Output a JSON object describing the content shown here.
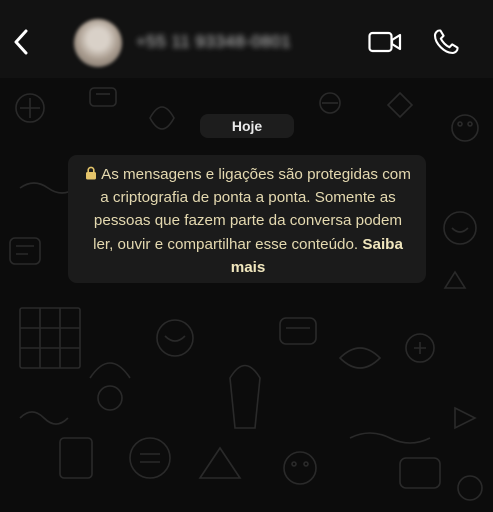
{
  "header": {
    "back_icon": "chevron-left-icon",
    "contact_name": "+55 11 93348-0801",
    "video_icon": "video-camera-icon",
    "call_icon": "phone-icon"
  },
  "chat": {
    "date_label": "Hoje",
    "encryption_notice": {
      "icon": "lock-icon",
      "text": "As mensagens e ligações são protegidas com a criptografia de ponta a ponta. Somente as pessoas que fazem parte da conversa podem ler, ouvir e compartilhar esse conteúdo.",
      "link_label": "Saiba mais"
    }
  },
  "colors": {
    "header_bg": "#121212",
    "chat_bg": "#0c0c0c",
    "notice_bg": "#1b1b1b",
    "notice_text": "#e4d9b0"
  }
}
